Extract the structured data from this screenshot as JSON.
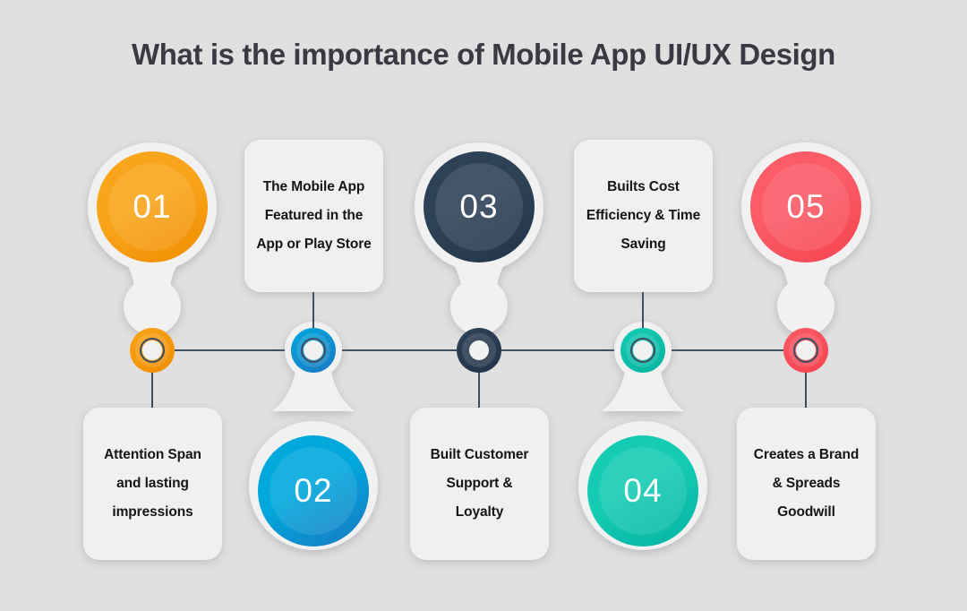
{
  "page": {
    "title": "What is the importance of Mobile App UI/UX Design",
    "background_color": "#e0e0e0",
    "line_color": "#3f4d61",
    "card_background": "#f0f0f0",
    "pin_color": "#f1f1f1"
  },
  "steps": [
    {
      "number": "01",
      "text": "Attention Span and lasting impressions",
      "color": "#f9a51b",
      "color_dark": "#f08c00",
      "number_position": "top",
      "card_position": "bottom"
    },
    {
      "number": "02",
      "text": "The Mobile App Featured in the App or Play Store",
      "color": "#00a8dc",
      "color_dark": "#1a78c2",
      "number_position": "bottom",
      "card_position": "top"
    },
    {
      "number": "03",
      "text": "Built Customer Support & Loyalty",
      "color": "#2e4257",
      "color_dark": "#22344a",
      "number_position": "top",
      "card_position": "bottom"
    },
    {
      "number": "04",
      "text": "Builts Cost Efficiency & Time Saving",
      "color": "#15cbb4",
      "color_dark": "#05b3a2",
      "number_position": "bottom",
      "card_position": "top"
    },
    {
      "number": "05",
      "text": "Creates a Brand & Spreads Goodwill",
      "color": "#fa5b66",
      "color_dark": "#f6434f",
      "number_position": "top",
      "card_position": "bottom"
    }
  ]
}
